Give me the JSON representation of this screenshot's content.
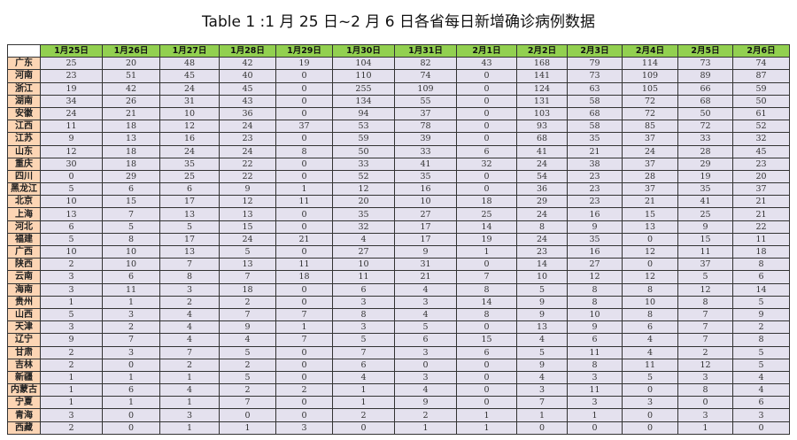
{
  "title": "Table 1 :1 月 25 日~2 月 6 日各省每日新增确诊病例数据",
  "colors": {
    "header_bg": "#92d050",
    "province_bg": "#fcd5b4",
    "cell_bg": "#e4e1ee"
  },
  "columns": [
    "1月25日",
    "1月26日",
    "1月27日",
    "1月28日",
    "1月29日",
    "1月30日",
    "1月31日",
    "2月1日",
    "2月2日",
    "2月3日",
    "2月4日",
    "2月5日",
    "2月6日"
  ],
  "rows": [
    {
      "province": "广东",
      "values": [
        25,
        20,
        48,
        42,
        19,
        104,
        82,
        43,
        168,
        79,
        114,
        73,
        74
      ]
    },
    {
      "province": "河南",
      "values": [
        23,
        51,
        45,
        40,
        0,
        110,
        74,
        0,
        141,
        73,
        109,
        89,
        87
      ]
    },
    {
      "province": "浙江",
      "values": [
        19,
        42,
        24,
        45,
        0,
        255,
        109,
        0,
        124,
        63,
        105,
        66,
        59
      ]
    },
    {
      "province": "湖南",
      "values": [
        34,
        26,
        31,
        43,
        0,
        134,
        55,
        0,
        131,
        58,
        72,
        68,
        50
      ]
    },
    {
      "province": "安徽",
      "values": [
        24,
        21,
        10,
        36,
        0,
        94,
        37,
        0,
        103,
        68,
        72,
        50,
        61
      ]
    },
    {
      "province": "江西",
      "values": [
        11,
        18,
        12,
        24,
        37,
        53,
        78,
        0,
        93,
        58,
        85,
        72,
        52
      ]
    },
    {
      "province": "江苏",
      "values": [
        9,
        13,
        16,
        23,
        0,
        59,
        39,
        0,
        68,
        35,
        37,
        33,
        32
      ]
    },
    {
      "province": "山东",
      "values": [
        12,
        18,
        24,
        24,
        8,
        50,
        33,
        6,
        41,
        21,
        24,
        28,
        45
      ]
    },
    {
      "province": "重庆",
      "values": [
        30,
        18,
        35,
        22,
        0,
        33,
        41,
        32,
        24,
        38,
        37,
        29,
        23
      ]
    },
    {
      "province": "四川",
      "values": [
        0,
        29,
        25,
        22,
        0,
        52,
        35,
        0,
        54,
        23,
        28,
        19,
        20
      ]
    },
    {
      "province": "黑龙江",
      "values": [
        5,
        6,
        6,
        9,
        1,
        12,
        16,
        0,
        36,
        23,
        37,
        35,
        37
      ]
    },
    {
      "province": "北京",
      "values": [
        10,
        15,
        17,
        12,
        11,
        20,
        10,
        18,
        29,
        23,
        21,
        41,
        21
      ]
    },
    {
      "province": "上海",
      "values": [
        13,
        7,
        13,
        13,
        0,
        35,
        27,
        25,
        24,
        16,
        15,
        25,
        21
      ]
    },
    {
      "province": "河北",
      "values": [
        6,
        5,
        5,
        15,
        0,
        32,
        17,
        14,
        8,
        9,
        13,
        9,
        22
      ]
    },
    {
      "province": "福建",
      "values": [
        5,
        8,
        17,
        24,
        21,
        4,
        17,
        19,
        24,
        35,
        0,
        15,
        11
      ]
    },
    {
      "province": "广西",
      "values": [
        10,
        10,
        13,
        5,
        0,
        27,
        9,
        1,
        23,
        16,
        12,
        11,
        18
      ]
    },
    {
      "province": "陕西",
      "values": [
        2,
        10,
        7,
        13,
        11,
        10,
        31,
        0,
        14,
        27,
        0,
        37,
        8
      ]
    },
    {
      "province": "云南",
      "values": [
        3,
        6,
        8,
        7,
        18,
        11,
        21,
        7,
        10,
        12,
        12,
        5,
        6
      ]
    },
    {
      "province": "海南",
      "values": [
        3,
        11,
        3,
        18,
        0,
        6,
        4,
        8,
        5,
        8,
        8,
        12,
        14
      ]
    },
    {
      "province": "贵州",
      "values": [
        1,
        1,
        2,
        2,
        0,
        3,
        3,
        14,
        9,
        8,
        10,
        8,
        5
      ]
    },
    {
      "province": "山西",
      "values": [
        5,
        3,
        4,
        7,
        7,
        8,
        4,
        8,
        9,
        10,
        8,
        7,
        9
      ]
    },
    {
      "province": "天津",
      "values": [
        3,
        2,
        4,
        9,
        1,
        3,
        5,
        0,
        13,
        9,
        6,
        7,
        2
      ]
    },
    {
      "province": "辽宁",
      "values": [
        9,
        7,
        4,
        4,
        7,
        5,
        6,
        15,
        4,
        6,
        4,
        7,
        8
      ]
    },
    {
      "province": "甘肃",
      "values": [
        2,
        3,
        7,
        5,
        0,
        7,
        3,
        6,
        5,
        11,
        4,
        2,
        5
      ]
    },
    {
      "province": "吉林",
      "values": [
        2,
        0,
        2,
        2,
        0,
        6,
        0,
        0,
        9,
        8,
        11,
        12,
        5
      ]
    },
    {
      "province": "新疆",
      "values": [
        1,
        1,
        1,
        5,
        0,
        4,
        3,
        0,
        4,
        3,
        5,
        3,
        4
      ]
    },
    {
      "province": "内蒙古",
      "values": [
        1,
        6,
        4,
        2,
        2,
        1,
        4,
        0,
        3,
        11,
        0,
        8,
        4
      ]
    },
    {
      "province": "宁夏",
      "values": [
        1,
        1,
        1,
        7,
        0,
        1,
        9,
        0,
        7,
        3,
        3,
        0,
        6
      ]
    },
    {
      "province": "青海",
      "values": [
        3,
        0,
        3,
        0,
        0,
        2,
        2,
        1,
        1,
        1,
        0,
        3,
        3
      ]
    },
    {
      "province": "西藏",
      "values": [
        2,
        0,
        1,
        1,
        3,
        0,
        1,
        1,
        0,
        0,
        0,
        1,
        0
      ]
    }
  ]
}
